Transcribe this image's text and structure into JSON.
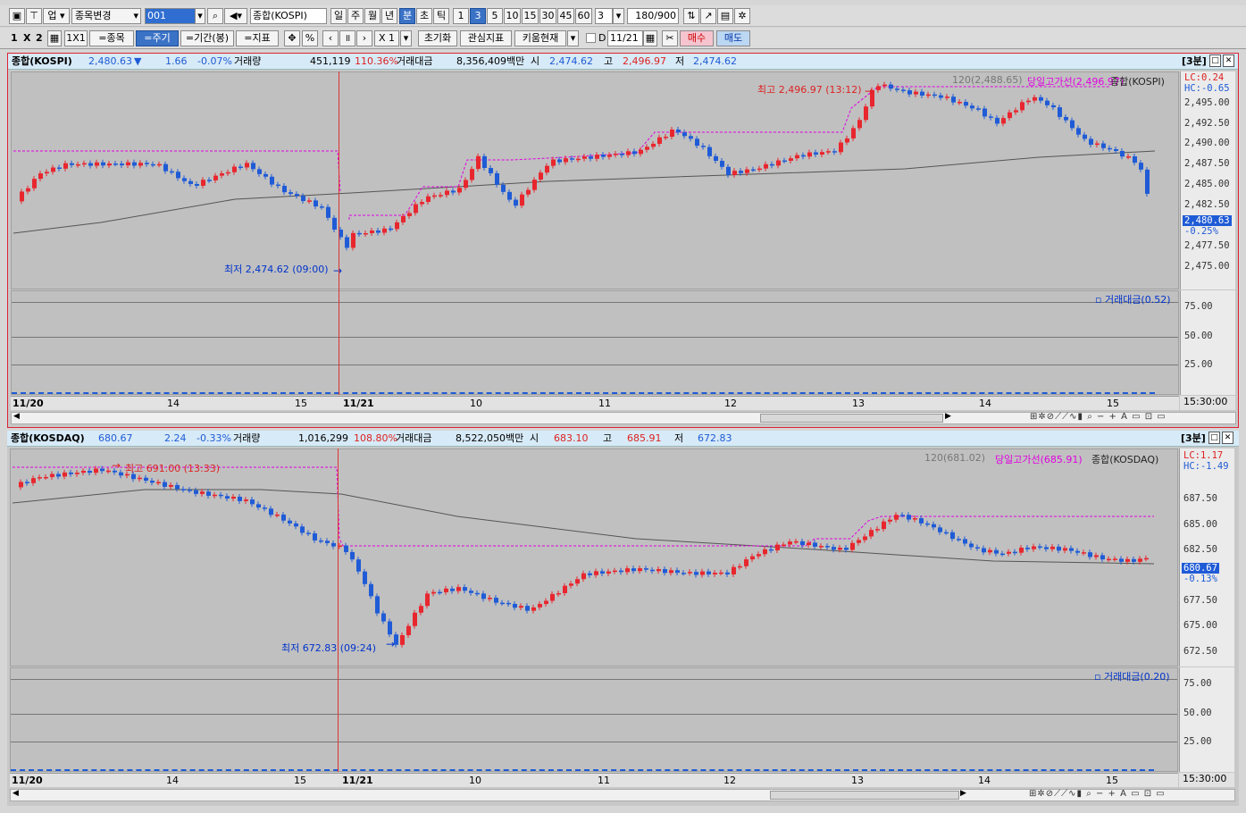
{
  "toolbar1": {
    "code": "001",
    "period_label": "업",
    "symbol_dropdown": "종목변경",
    "name_box": "종합(KOSPI)",
    "period_buttons": [
      "일",
      "주",
      "월",
      "년",
      "분",
      "초",
      "틱"
    ],
    "interval_buttons": [
      "1",
      "3",
      "5",
      "10",
      "15",
      "30",
      "45",
      "60"
    ],
    "interval_value": "3",
    "count_value": "180",
    "count_max": "/900"
  },
  "toolbar2": {
    "layout": [
      "1",
      "X",
      "2"
    ],
    "btn_1x1": "1X1",
    "btn_item": "=종목",
    "btn_period": "=주기",
    "btn_range": "=기간(봉)",
    "btn_indicator": "=지표",
    "btn_pct": "%",
    "zoom": "X 1",
    "btn_reset": "초기화",
    "btn_watch": "관심지표",
    "btn_kiwoom": "키움현재",
    "date_check": "D",
    "date_value": "11/21",
    "btn_buy": "매수",
    "btn_sell": "매도"
  },
  "kospi": {
    "name": "종합(KOSPI)",
    "price": "2,480.63",
    "arrow": "▼",
    "change": "1.66",
    "change_pct": "-0.07%",
    "vol_label": "거래량",
    "volume": "451,119",
    "vol_ratio": "110.36%",
    "amt_label": "거래대금",
    "amount": "8,356,409백만",
    "open_label": "시",
    "open": "2,474.62",
    "high_label": "고",
    "high": "2,496.97",
    "low_label": "저",
    "low": "2,474.62",
    "interval_tag": "[3분]",
    "ma_label": "120(2,488.65)",
    "high_line_label": "당일고가선(2,496.97)",
    "series_label": "종합(KOSPI)",
    "lc": "LC:0.24",
    "hc": "HC:-0.65",
    "max_label": "최고 2,496.97 (13:12)",
    "min_label": "최저 2,474.62 (09:00)",
    "price_tag": "2,480.63",
    "pct_tag": "-0.25%",
    "vol_panel_label": "거래대금(0.52)",
    "yticks": [
      "2,495.00",
      "2,492.50",
      "2,490.00",
      "2,487.50",
      "2,485.00",
      "2,482.50",
      "2,480.00",
      "2,477.50",
      "2,475.00"
    ],
    "vticks": [
      "75.00",
      "50.00",
      "25.00"
    ]
  },
  "kosdaq": {
    "name": "종합(KOSDAQ)",
    "price": "680.67",
    "arrow": "",
    "change": "2.24",
    "change_pct": "-0.33%",
    "vol_label": "거래량",
    "volume": "1,016,299",
    "vol_ratio": "108.80%",
    "amt_label": "거래대금",
    "amount": "8,522,050백만",
    "open_label": "시",
    "open": "683.10",
    "high_label": "고",
    "high": "685.91",
    "low_label": "저",
    "low": "672.83",
    "interval_tag": "[3분]",
    "ma_label": "120(681.02)",
    "high_line_label": "당일고가선(685.91)",
    "series_label": "종합(KOSDAQ)",
    "lc": "LC:1.17",
    "hc": "HC:-1.49",
    "max_label": "최고 691.00 (13:33)",
    "min_label": "최저 672.83 (09:24)",
    "price_tag": "680.67",
    "pct_tag": "-0.13%",
    "vol_panel_label": "거래대금(0.20)",
    "yticks": [
      "687.50",
      "685.00",
      "682.50",
      "680.00",
      "677.50",
      "675.00",
      "672.50"
    ],
    "vticks": [
      "75.00",
      "50.00",
      "25.00"
    ]
  },
  "xaxis": {
    "labels": [
      "11/20",
      "14",
      "15",
      "11/21",
      "10",
      "11",
      "12",
      "13",
      "14",
      "15"
    ],
    "end_time": "15:30:00"
  },
  "colors": {
    "up": "#e8262e",
    "down": "#1f5bd6",
    "ma": "#555555",
    "high_line": "#e000e0",
    "cursor": "#d33333"
  },
  "icons": [
    "chart-icon",
    "pin-icon",
    "search-icon",
    "sound-icon",
    "tools-icon",
    "save-icon",
    "settings-icon",
    "move-icon",
    "prev-icon",
    "pause-icon",
    "next-icon",
    "calendar-icon",
    "scissors-icon",
    "zoom-in-icon",
    "zoom-out-icon"
  ]
}
